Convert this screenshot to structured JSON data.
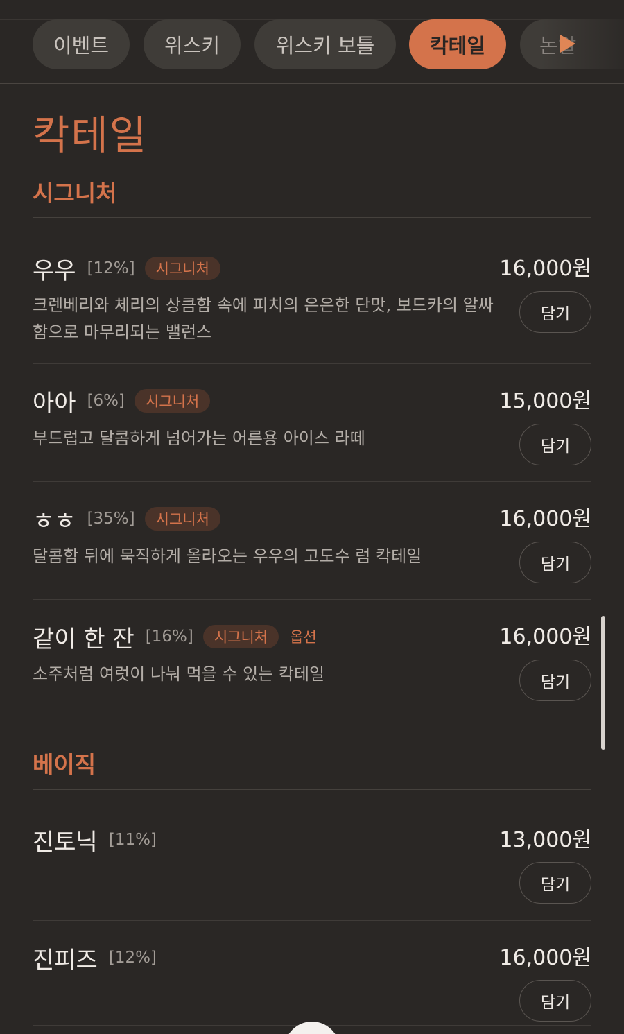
{
  "tabs": [
    {
      "label": "이벤트"
    },
    {
      "label": "위스키"
    },
    {
      "label": "위스키 보틀"
    },
    {
      "label": "칵테일"
    },
    {
      "label": "논알"
    }
  ],
  "page_title": "칵테일",
  "sections": [
    {
      "title": "시그니처",
      "items": [
        {
          "name": "우우",
          "abv": "[12%]",
          "badge": "시그니처",
          "price": "16,000원",
          "desc": "크렌베리와 체리의 상큼함 속에 피치의 은은한 단맛, 보드카의 알싸함으로 마무리되는 밸런스",
          "cart": "담기"
        },
        {
          "name": "아아",
          "abv": "[6%]",
          "badge": "시그니처",
          "price": "15,000원",
          "desc": "부드럽고 달콤하게 넘어가는 어른용 아이스 라떼",
          "cart": "담기"
        },
        {
          "name": "ㅎㅎ",
          "abv": "[35%]",
          "badge": "시그니처",
          "price": "16,000원",
          "desc": "달콤함 뒤에 묵직하게 올라오는 우우의 고도수 럼 칵테일",
          "cart": "담기"
        },
        {
          "name": "같이 한 잔",
          "abv": "[16%]",
          "badge": "시그니처",
          "option": "옵션",
          "price": "16,000원",
          "desc": "소주처럼 여럿이 나눠 먹을 수 있는 칵테일",
          "cart": "담기"
        }
      ]
    },
    {
      "title": "베이직",
      "items": [
        {
          "name": "진토닉",
          "abv": "[11%]",
          "price": "13,000원",
          "cart": "담기"
        },
        {
          "name": "진피즈",
          "abv": "[12%]",
          "price": "16,000원",
          "cart": "담기"
        }
      ]
    }
  ],
  "colors": {
    "accent": "#d4734b",
    "background": "#2a2725",
    "tab_bg": "#3f3c38"
  }
}
